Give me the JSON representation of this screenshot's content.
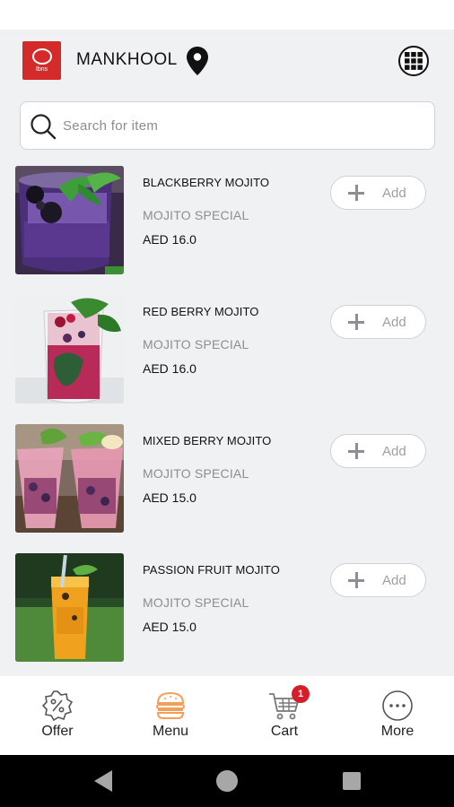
{
  "header": {
    "logo_text": "Ibns",
    "brand": "MANKHOOL"
  },
  "search": {
    "placeholder": "Search for item"
  },
  "menu_items": [
    {
      "name": "BLACKBERRY MOJITO",
      "category": "MOJITO SPECIAL",
      "price": "AED 16.0",
      "add_label": "Add"
    },
    {
      "name": "RED BERRY MOJITO",
      "category": "MOJITO SPECIAL",
      "price": "AED 16.0",
      "add_label": "Add"
    },
    {
      "name": "MIXED BERRY MOJITO",
      "category": "MOJITO SPECIAL",
      "price": "AED 15.0",
      "add_label": "Add"
    },
    {
      "name": "PASSION FRUIT MOJITO",
      "category": "MOJITO SPECIAL",
      "price": "AED 15.0",
      "add_label": "Add"
    }
  ],
  "bottom_nav": {
    "offer": "Offer",
    "menu": "Menu",
    "cart": "Cart",
    "cart_badge": "1",
    "more": "More"
  },
  "colors": {
    "accent_orange": "#f0a05a",
    "brand_red": "#d42a2a",
    "badge_red": "#d41f2a"
  },
  "icons": {
    "location": "location-pin-icon",
    "grid": "grid-icon",
    "search": "search-icon",
    "offer": "offer-badge-icon",
    "menu": "burger-icon",
    "cart": "cart-icon",
    "more": "more-dots-icon"
  }
}
